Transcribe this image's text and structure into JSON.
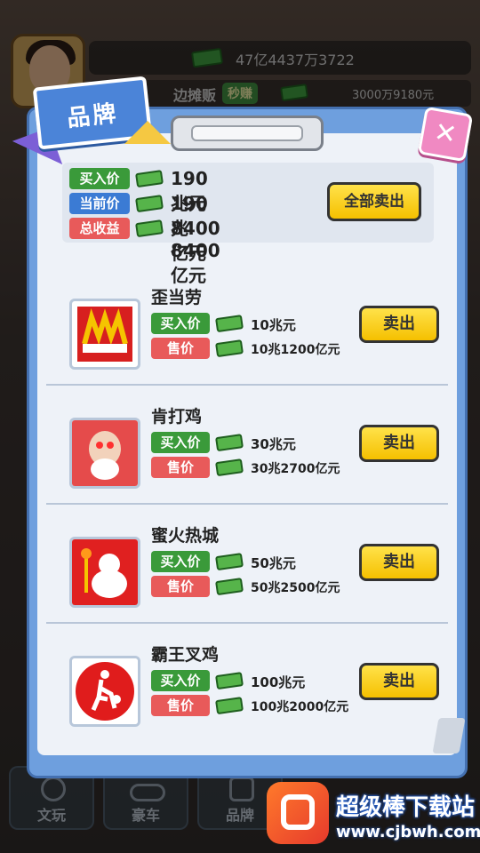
{
  "hud": {
    "total_money": "47亿4437万3722",
    "stall_text": "边摊贩",
    "quick_earn_label": "秒赚",
    "income": "3000万9180元"
  },
  "panel": {
    "title": "品牌",
    "close_label": "✕",
    "summary": {
      "buy_label": "买入价",
      "buy_value": "190兆元",
      "current_label": "当前价",
      "current_value": "190兆8400亿元",
      "profit_label": "总收益",
      "profit_value": "8400亿元",
      "sell_all_label": "全部卖出"
    },
    "items": [
      {
        "name": "歪当劳",
        "buy_label": "买入价",
        "buy_value": "10兆元",
        "sell_label": "售价",
        "sell_value": "10兆1200亿元",
        "button": "卖出",
        "logo": "mcdonalds-parody-logo"
      },
      {
        "name": "肯打鸡",
        "buy_label": "买入价",
        "buy_value": "30兆元",
        "sell_label": "售价",
        "sell_value": "30兆2700亿元",
        "button": "卖出",
        "logo": "kfc-parody-logo"
      },
      {
        "name": "蜜火热城",
        "buy_label": "买入价",
        "buy_value": "50兆元",
        "sell_label": "售价",
        "sell_value": "50兆2500亿元",
        "button": "卖出",
        "logo": "mixue-parody-logo"
      },
      {
        "name": "霸王叉鸡",
        "buy_label": "买入价",
        "buy_value": "100兆元",
        "sell_label": "售价",
        "sell_value": "100兆2000亿元",
        "button": "卖出",
        "logo": "basketball-player-logo"
      }
    ]
  },
  "bottom_nav": [
    {
      "label": "文玩",
      "icon": "beads-icon"
    },
    {
      "label": "豪车",
      "icon": "car-icon"
    },
    {
      "label": "品牌",
      "icon": "brand-icon"
    }
  ],
  "watermark": {
    "title": "超级棒下载站",
    "url": "www.cjbwh.com"
  },
  "colors": {
    "buy_tag": "#3a9a3a",
    "current_tag": "#3b7bd4",
    "profit_tag": "#e85a5a",
    "sell_button": "#f5c000",
    "panel_blue": "#6e9fde"
  }
}
